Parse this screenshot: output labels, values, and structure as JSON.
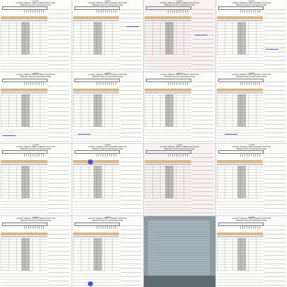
{
  "form": {
    "title": "TRANS",
    "subtitle_1": "ALASKA CENTRAL DIRECT PRIMARY ELECTION",
    "subtitle_2": "PRECINCT BALLOT RECONCILIATION"
  },
  "sheets": [
    {
      "variant": "plain",
      "ink": ""
    },
    {
      "variant": "plain",
      "ink": ""
    },
    {
      "variant": "tinted",
      "ink": ""
    },
    {
      "variant": "plain",
      "ink": ""
    },
    {
      "variant": "plain",
      "ink": ""
    },
    {
      "variant": "plain",
      "ink": ""
    },
    {
      "variant": "plain",
      "ink": ""
    },
    {
      "variant": "plain",
      "ink": ""
    },
    {
      "variant": "plain",
      "ink": ""
    },
    {
      "variant": "plain",
      "ink": ""
    },
    {
      "variant": "tinted",
      "ink": ""
    },
    {
      "variant": "plain",
      "ink": ""
    },
    {
      "variant": "plain",
      "ink": ""
    },
    {
      "variant": "plain",
      "ink": ""
    },
    {
      "variant": "photo",
      "ink": ""
    },
    {
      "variant": "plain",
      "ink": ""
    }
  ],
  "colors": {
    "ink_blue": "#2845b8",
    "band_tan": "#d8b98a"
  }
}
